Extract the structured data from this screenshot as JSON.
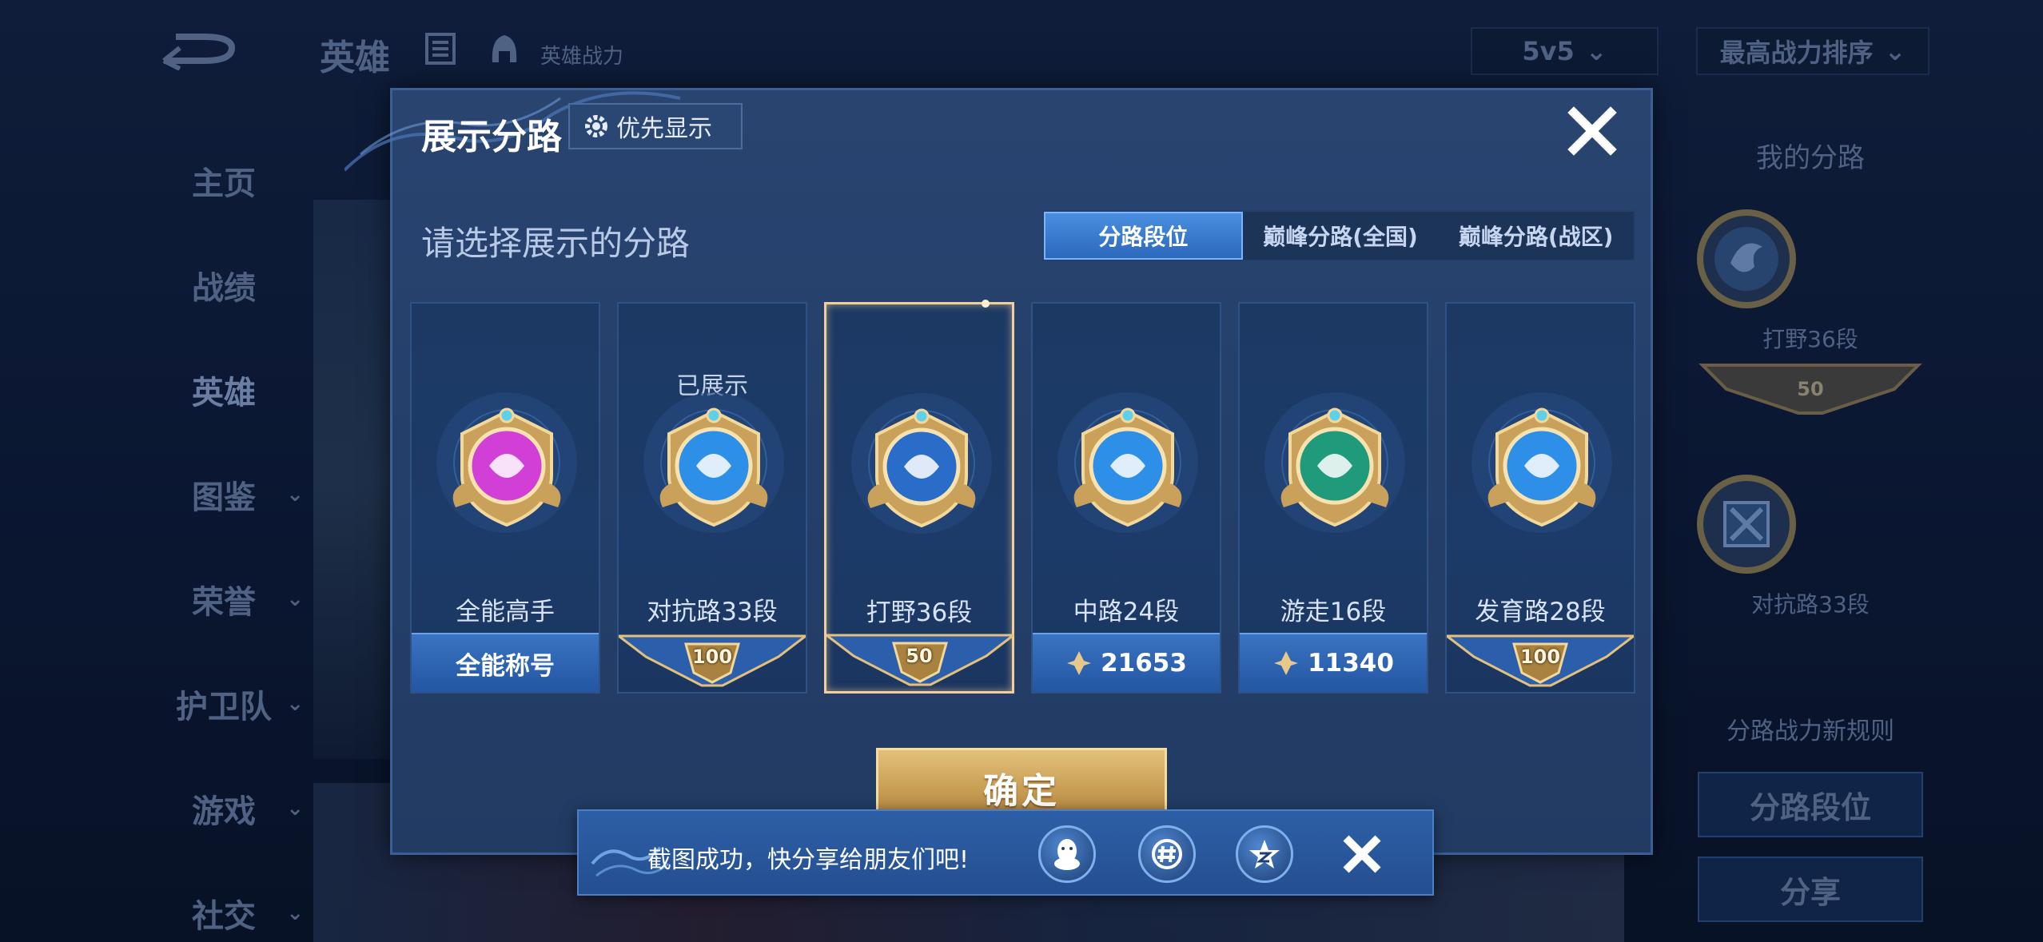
{
  "background": {
    "top_title": "英雄",
    "power_label": "英雄战力",
    "mode_select": "5v5",
    "sort_select": "最高战力排序",
    "nav": [
      {
        "label": "主页",
        "chevron": false
      },
      {
        "label": "战绩",
        "chevron": false
      },
      {
        "label": "英雄",
        "chevron": false,
        "active": true
      },
      {
        "label": "图鉴",
        "chevron": true
      },
      {
        "label": "荣誉",
        "chevron": true
      },
      {
        "label": "护卫队",
        "chevron": true
      },
      {
        "label": "游戏",
        "chevron": true
      },
      {
        "label": "社交",
        "chevron": true
      }
    ],
    "right_panel": {
      "title": "我的分路",
      "items": [
        {
          "label": "打野36段",
          "level": "50"
        },
        {
          "label": "对抗路33段",
          "level": ""
        }
      ],
      "rule_link": "分路战力新规则",
      "lane_rank_button": "分路段位",
      "share_button": "分享"
    }
  },
  "modal": {
    "title": "展示分路",
    "priority_button": "优先显示",
    "subtitle": "请选择展示的分路",
    "tabs": [
      {
        "label": "分路段位",
        "active": true
      },
      {
        "label": "巅峰分路(全国)",
        "active": false
      },
      {
        "label": "巅峰分路(战区)",
        "active": false
      }
    ],
    "cards": [
      {
        "name": "全能高手",
        "status": "",
        "bottom_type": "text",
        "bottom_value": "全能称号",
        "emblem": "allround-emblem",
        "emblem_color": "#d23fd6",
        "selected": false
      },
      {
        "name": "对抗路33段",
        "status": "已展示",
        "bottom_type": "banner",
        "bottom_value": "100",
        "emblem": "clash-lane-emblem",
        "emblem_color": "#2e8fe8",
        "selected": false
      },
      {
        "name": "打野36段",
        "status": "",
        "bottom_type": "banner",
        "bottom_value": "50",
        "emblem": "jungle-dragon-emblem",
        "emblem_color": "#2a6dc8",
        "selected": true
      },
      {
        "name": "中路24段",
        "status": "",
        "bottom_type": "score",
        "bottom_value": "21653",
        "emblem": "mid-lane-emblem",
        "emblem_color": "#2e8fe8",
        "selected": false
      },
      {
        "name": "游走16段",
        "status": "",
        "bottom_type": "score",
        "bottom_value": "11340",
        "emblem": "roam-wings-emblem",
        "emblem_color": "#1f9a7a",
        "selected": false
      },
      {
        "name": "发育路28段",
        "status": "",
        "bottom_type": "banner",
        "bottom_value": "100",
        "emblem": "farm-lane-emblem",
        "emblem_color": "#2e8fe8",
        "selected": false
      }
    ],
    "confirm_button": "确定"
  },
  "toast": {
    "text": "截图成功，快分享给朋友们吧!",
    "icons": [
      "qq-icon",
      "wechat-moments-icon",
      "qzone-icon",
      "close-icon"
    ]
  },
  "colors": {
    "accent_gold": "#f2cf9a",
    "tab_active": "#3a7dd4",
    "modal_bg": "#24406b"
  }
}
